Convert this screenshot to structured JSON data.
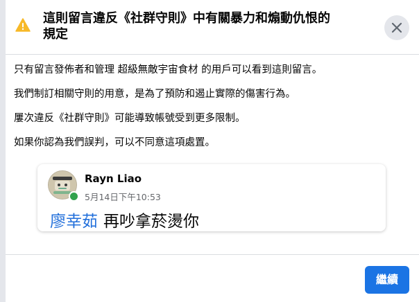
{
  "dialog": {
    "title_line1": "這則留言違反《社群守則》中有關暴力和煽動仇恨的",
    "title_line2": "規定",
    "icons": {
      "warning": "warning-triangle-icon",
      "close": "close-x-icon"
    },
    "paragraphs": [
      "只有留言發佈者和管理 超級無敵宇宙食材 的用戶可以看到這則留言。",
      "我們制訂相關守則的用意，是為了預防和遏止實際的傷害行為。",
      "屢次違反《社群守則》可能導致帳號受到更多限制。",
      "如果你認為我們誤判，可以不同意這項處置。"
    ],
    "comment": {
      "author": "Rayn Liao",
      "timestamp": "5月14日下午10:53",
      "mention": "廖幸茹",
      "text": "再吵拿菸燙你",
      "online": true
    },
    "continue_label": "繼續"
  },
  "colors": {
    "accent": "#1b74e4",
    "mention": "#216fdb",
    "warning": "#f7b928",
    "online": "#31a24c"
  }
}
